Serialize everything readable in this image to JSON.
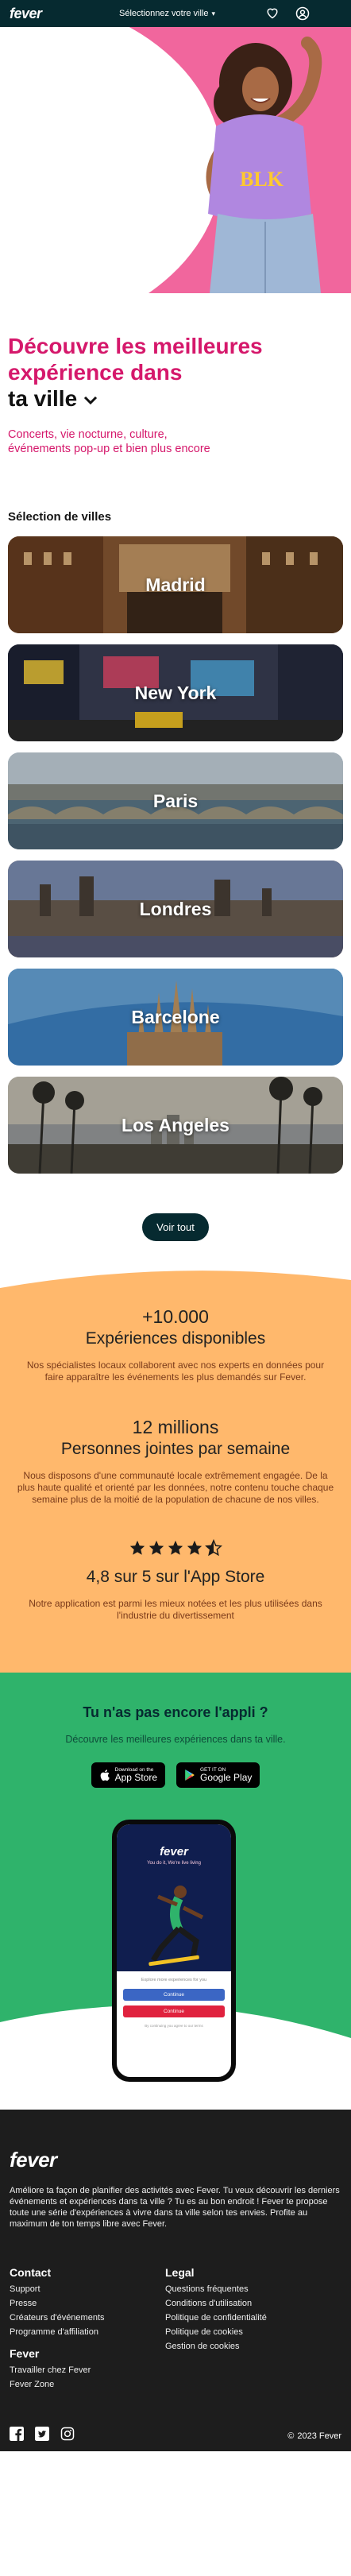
{
  "header": {
    "logo": "fever",
    "city_select": "Sélectionnez votre ville"
  },
  "hero": {
    "title": "Découvre les meilleures expérience dans",
    "city_line": "ta ville",
    "subtitle": "Concerts, vie nocturne, culture, événements pop-up et bien plus encore",
    "shirt_text": "BLK"
  },
  "cities": {
    "heading": "Sélection de villes",
    "items": [
      {
        "name": "Madrid"
      },
      {
        "name": "New York"
      },
      {
        "name": "Paris"
      },
      {
        "name": "Londres"
      },
      {
        "name": "Barcelone"
      },
      {
        "name": "Los Angeles"
      }
    ],
    "see_all": "Voir tout"
  },
  "stats": {
    "items": [
      {
        "big": "+10.000",
        "label": "Expériences disponibles",
        "desc": "Nos spécialistes locaux collaborent avec nos experts en données pour faire apparaître les événements les plus demandés sur Fever."
      },
      {
        "big": "12 millions",
        "label": "Personnes jointes par semaine",
        "desc": "Nous disposons d'une communauté locale extrêmement engagée. De la plus haute qualité et orienté par les données, notre contenu touche chaque semaine plus de la moitié de la population de chacune de nos villes."
      }
    ],
    "rating": {
      "stars": 4.5,
      "text": "4,8 sur 5 sur l'App Store",
      "desc": "Notre application est parmi les mieux notées et les plus utilisées dans l'industrie du divertissement"
    }
  },
  "app": {
    "title": "Tu n'as pas encore l'appli ?",
    "subtitle": "Découvre les meilleures expériences dans ta ville.",
    "appstore_small": "Download on the",
    "appstore_big": "App Store",
    "gplay_small": "GET IT ON",
    "gplay_big": "Google Play",
    "phone": {
      "logo": "fever",
      "tagline": "You do it, We're live living",
      "hint": "Explore more experiences for you",
      "btn_facebook": "Continue",
      "btn_google": "Continue",
      "legal": "By continuing you agree to our terms"
    }
  },
  "footer": {
    "logo": "fever",
    "description": "Améliore ta façon de planifier des activités avec Fever. Tu veux découvrir les derniers événements et expériences dans ta ville ? Tu es au bon endroit ! Fever te propose toute une série d'expériences à vivre dans ta ville selon tes envies. Profite au maximum de ton temps libre avec Fever.",
    "contact": {
      "heading": "Contact",
      "links": [
        "Support",
        "Presse",
        "Créateurs d'événements",
        "Programme d'affiliation"
      ]
    },
    "fever": {
      "heading": "Fever",
      "links": [
        "Travailler chez Fever",
        "Fever Zone"
      ]
    },
    "legal": {
      "heading": "Legal",
      "links": [
        "Questions fréquentes",
        "Conditions d'utilisation",
        "Politique de confidentialité",
        "Politique de cookies",
        "Gestion de cookies"
      ]
    },
    "copyright": "2023 Fever"
  },
  "colors": {
    "dark": "#062a30",
    "pink": "#f1669d",
    "magenta": "#d5186b",
    "orange": "#ffb86c",
    "green": "#2fb36b",
    "footer": "#1d1d1d"
  }
}
